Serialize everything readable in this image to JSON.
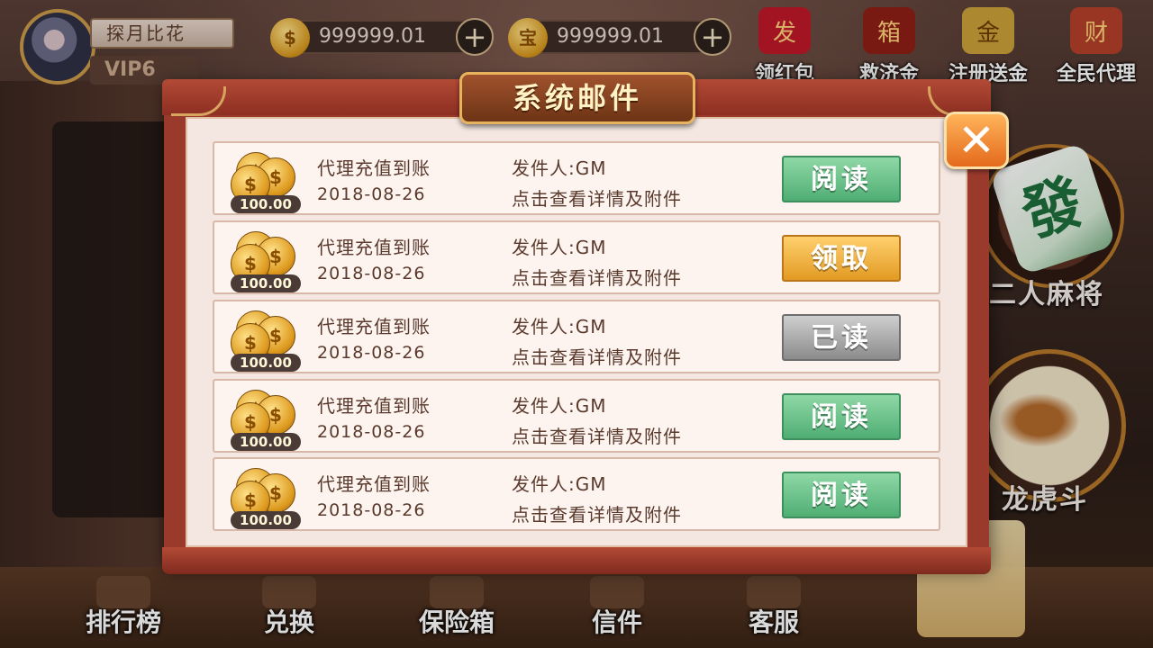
{
  "player": {
    "name": "探月比花",
    "vip": "VIP6"
  },
  "currencies": [
    {
      "icon": "gold-coin-icon",
      "glyph": "$",
      "amount": "999999.01"
    },
    {
      "icon": "treasure-coin-icon",
      "glyph": "宝",
      "amount": "999999.01"
    }
  ],
  "top_icons": [
    {
      "id": "red-packet",
      "label": "领红包",
      "glyph": "发",
      "color": "#c0182a"
    },
    {
      "id": "relief-fund",
      "label": "救济金",
      "glyph": "箱",
      "color": "#8e1f14"
    },
    {
      "id": "register-bonus",
      "label": "注册送金",
      "glyph": "金",
      "color": "#caa23a"
    },
    {
      "id": "agent",
      "label": "全民代理",
      "glyph": "财",
      "color": "#b3402a"
    }
  ],
  "dialog": {
    "title": "系统邮件",
    "close_glyph": "✕",
    "mails": [
      {
        "coin_amount": "100.00",
        "subject": "代理充值到账",
        "date": "2018-08-26",
        "sender": "发件人:GM",
        "hint": "点击查看详情及附件",
        "action": "阅读",
        "state": "read"
      },
      {
        "coin_amount": "100.00",
        "subject": "代理充值到账",
        "date": "2018-08-26",
        "sender": "发件人:GM",
        "hint": "点击查看详情及附件",
        "action": "领取",
        "state": "claim"
      },
      {
        "coin_amount": "100.00",
        "subject": "代理充值到账",
        "date": "2018-08-26",
        "sender": "发件人:GM",
        "hint": "点击查看详情及附件",
        "action": "已读",
        "state": "done"
      },
      {
        "coin_amount": "100.00",
        "subject": "代理充值到账",
        "date": "2018-08-26",
        "sender": "发件人:GM",
        "hint": "点击查看详情及附件",
        "action": "阅读",
        "state": "read"
      },
      {
        "coin_amount": "100.00",
        "subject": "代理充值到账",
        "date": "2018-08-26",
        "sender": "发件人:GM",
        "hint": "点击查看详情及附件",
        "action": "阅读",
        "state": "read"
      }
    ]
  },
  "games": [
    {
      "id": "two-player-mahjong",
      "label": "二人麻将",
      "tile_glyph": "發"
    },
    {
      "id": "dragon-tiger",
      "label": "龙虎斗"
    }
  ],
  "bottom_nav": [
    {
      "id": "ranking",
      "label": "排行榜"
    },
    {
      "id": "exchange",
      "label": "兑换"
    },
    {
      "id": "safe",
      "label": "保险箱"
    },
    {
      "id": "mail",
      "label": "信件"
    },
    {
      "id": "service",
      "label": "客服"
    }
  ],
  "colors": {
    "accent_red": "#9a3a2d",
    "read_green": "#4fae73",
    "claim_gold": "#e29a23",
    "done_gray": "#8b8b8b"
  }
}
